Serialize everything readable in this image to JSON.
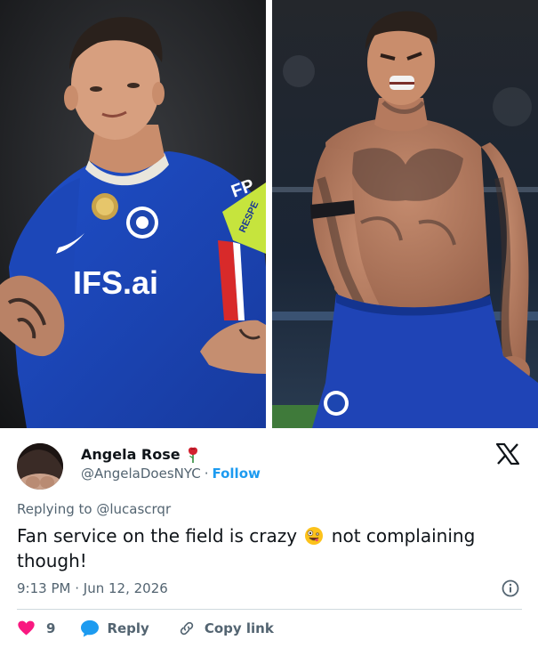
{
  "photos": {
    "left": {
      "sponsor_text": "IFS.ai",
      "sleeve_text": "FP",
      "armband_text": "RESPE"
    },
    "right": {}
  },
  "tweet": {
    "author": {
      "display_name": "Angela Rose",
      "handle": "@AngelaDoesNYC",
      "separator": "·",
      "follow_label": "Follow"
    },
    "reply_prefix": "Replying to ",
    "reply_handle": "@lucascrqr",
    "text_before_emoji": "Fan service on the field is crazy",
    "text_after_emoji": "not complaining though!",
    "time": "9:13 PM",
    "date": "Jun 12, 2026",
    "date_separator": "·",
    "likes": "9",
    "reply_label": "Reply",
    "copy_link_label": "Copy link",
    "colors": {
      "like_red": "#f91880",
      "link_blue": "#1d9bf0",
      "muted": "#536471"
    },
    "icons": [
      "rose-icon",
      "x-logo-icon",
      "zany-face-emoji",
      "info-icon",
      "heart-icon",
      "reply-bubble-icon",
      "link-icon"
    ]
  }
}
